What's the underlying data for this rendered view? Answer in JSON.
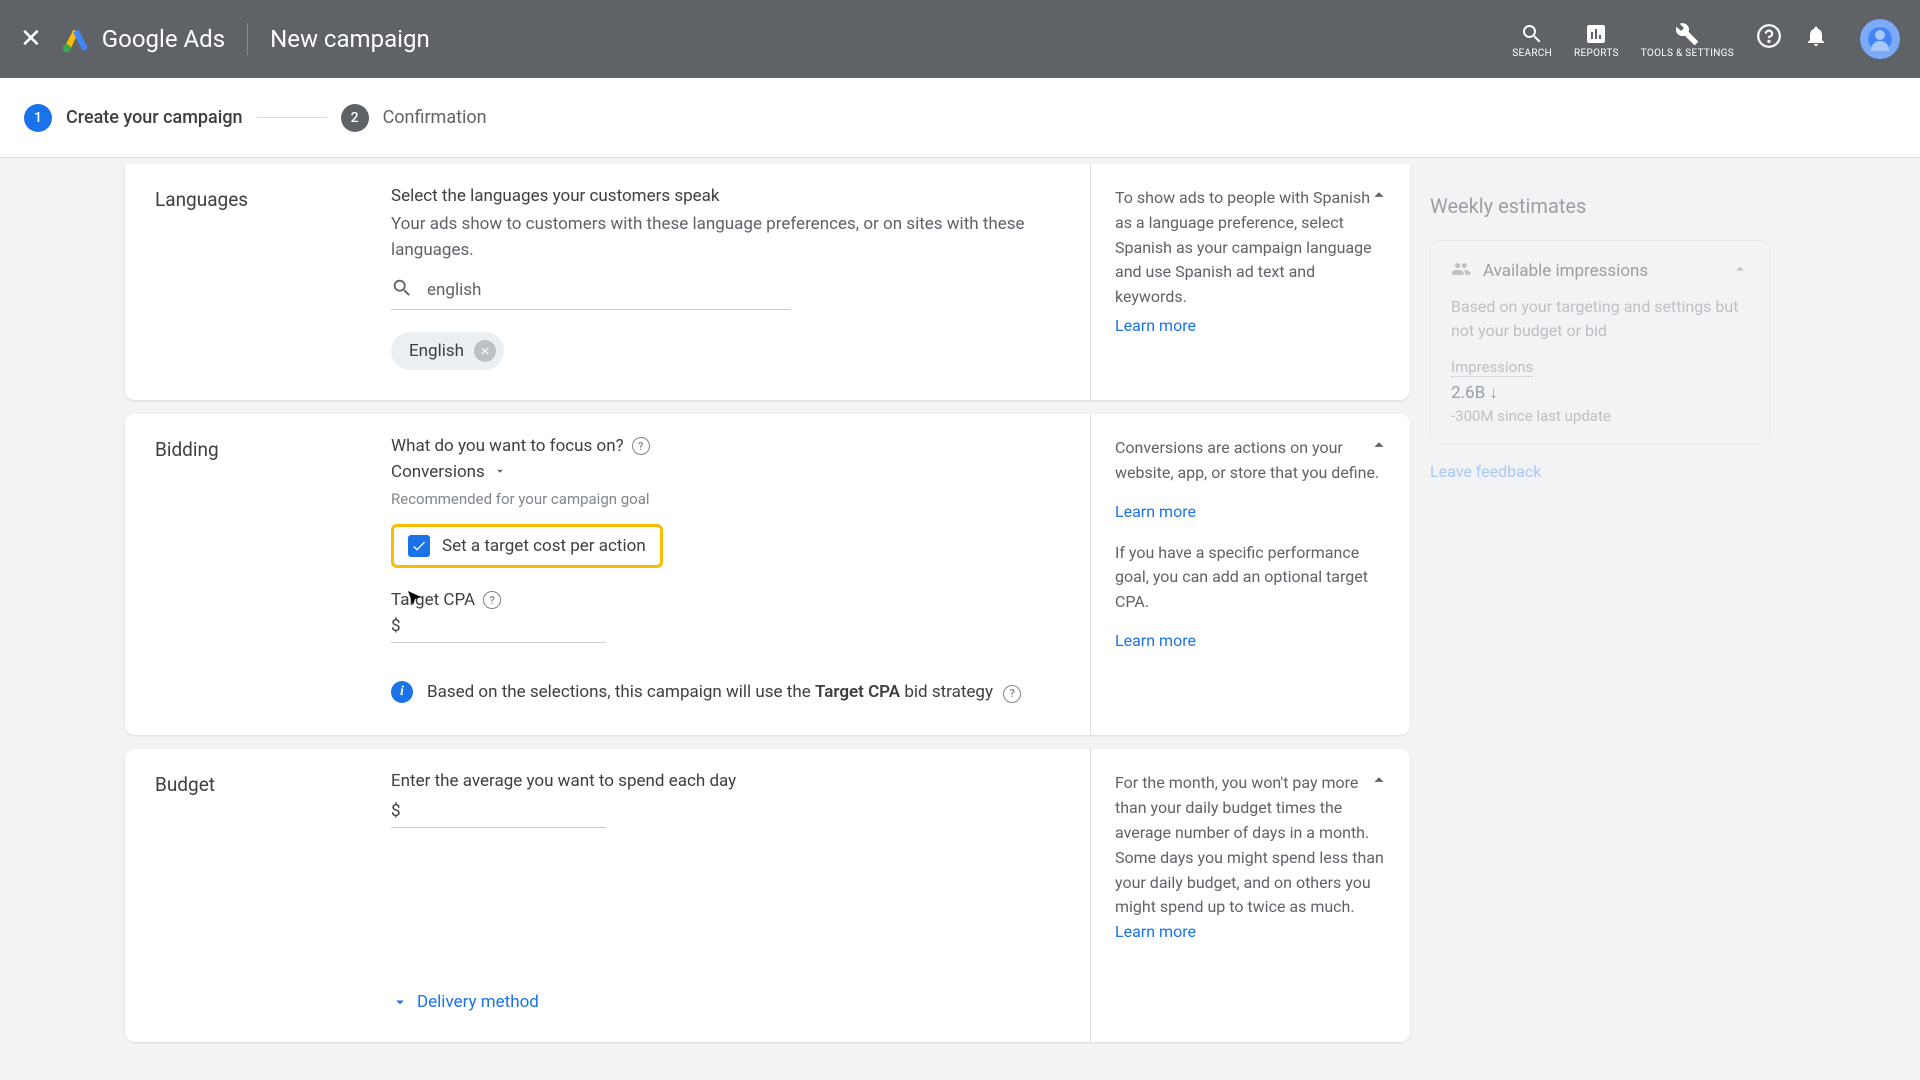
{
  "header": {
    "logo_text": "Google Ads",
    "page_title": "New campaign",
    "tools": {
      "search": "SEARCH",
      "reports": "REPORTS",
      "settings": "TOOLS & SETTINGS"
    }
  },
  "stepper": {
    "step1_num": "1",
    "step1_label": "Create your campaign",
    "step2_num": "2",
    "step2_label": "Confirmation"
  },
  "languages": {
    "title": "Languages",
    "heading": "Select the languages your customers speak",
    "hint": "Your ads show to customers with these language preferences, or on sites with these languages.",
    "search_value": "english",
    "chip": "English",
    "help": "To show ads to people with Spanish as a language preference, select Spanish as your campaign language and use Spanish ad text and keywords.",
    "learn_more": "Learn more"
  },
  "bidding": {
    "title": "Bidding",
    "focus_label": "What do you want to focus on?",
    "dropdown_value": "Conversions",
    "recommended": "Recommended for your campaign goal",
    "checkbox_label": "Set a target cost per action",
    "target_cpa_label": "Target CPA",
    "currency": "$",
    "info_pre": "Based on the selections, this campaign will use the ",
    "info_bold": "Target CPA",
    "info_post": " bid strategy",
    "help1": "Conversions are actions on your website, app, or store that you define.",
    "help2": "If you have a specific performance goal, you can add an optional target CPA.",
    "learn_more": "Learn more"
  },
  "budget": {
    "title": "Budget",
    "heading": "Enter the average you want to spend each day",
    "currency": "$",
    "delivery": "Delivery method",
    "help": "For the month, you won't pay more than your daily budget times the average number of days in a month. Some days you might spend less than your daily budget, and on others you might spend up to twice as much. ",
    "learn_more": "Learn more"
  },
  "sidebar": {
    "title": "Weekly estimates",
    "available": "Available impressions",
    "desc": "Based on your targeting and settings but not your budget or bid",
    "imp_label": "Impressions",
    "imp_value": "2.6B ↓",
    "imp_delta": "-300M since last update",
    "feedback": "Leave feedback"
  }
}
